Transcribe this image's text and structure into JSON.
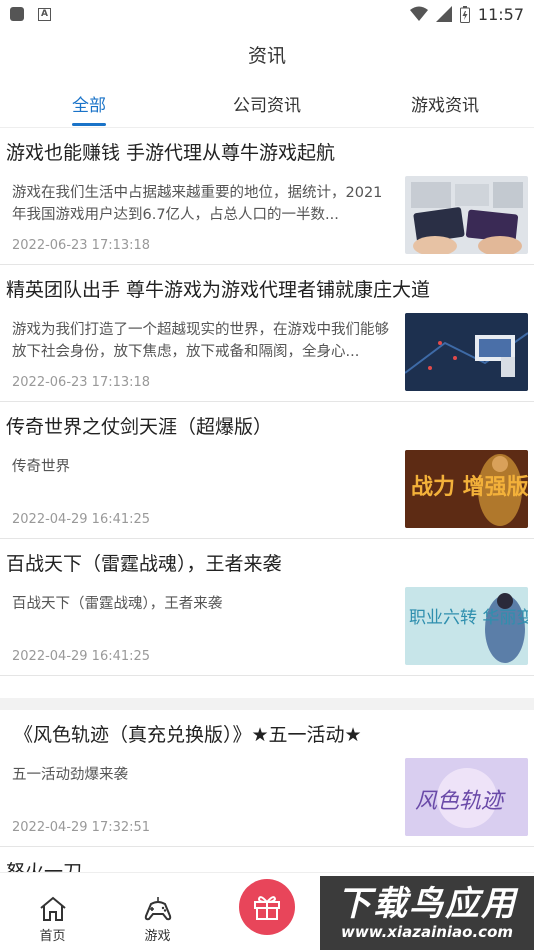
{
  "status_bar": {
    "time": "11:57"
  },
  "header": {
    "title": "资讯"
  },
  "tabs": [
    {
      "label": "全部",
      "active": true
    },
    {
      "label": "公司资讯",
      "active": false
    },
    {
      "label": "游戏资讯",
      "active": false
    }
  ],
  "articles": [
    {
      "title": "游戏也能赚钱 手游代理从尊牛游戏起航",
      "summary": "游戏在我们生活中占据越来越重要的地位，据统计，2021年我国游戏用户达到6.7亿人，占总人口的一半数...",
      "date": "2022-06-23 17:13:18"
    },
    {
      "title": "精英团队出手 尊牛游戏为游戏代理者铺就康庄大道",
      "summary": "游戏为我们打造了一个超越现实的世界，在游戏中我们能够放下社会身份，放下焦虑，放下戒备和隔阂，全身心...",
      "date": "2022-06-23 17:13:18"
    },
    {
      "title": "传奇世界之仗剑天涯（超爆版）",
      "summary": "传奇世界",
      "date": "2022-04-29 16:41:25",
      "thumb_text": "战力 增强版"
    },
    {
      "title": "百战天下（雷霆战魂），王者来袭",
      "summary": "百战天下（雷霆战魂），王者来袭",
      "date": "2022-04-29 16:41:25",
      "thumb_text": "职业六转 华丽变身"
    },
    {
      "title": "《风色轨迹（真充兑换版）》★五一活动★",
      "summary": "五一活动劲爆来袭",
      "date": "2022-04-29 17:32:51",
      "thumb_text": "风色轨迹"
    },
    {
      "title": "怒火一刀",
      "summary": "",
      "date": ""
    }
  ],
  "bottom_nav": {
    "home_label": "首页",
    "games_label": "游戏"
  },
  "watermark": {
    "title": "下载鸟应用",
    "url": "www.xiazainiao.com"
  }
}
